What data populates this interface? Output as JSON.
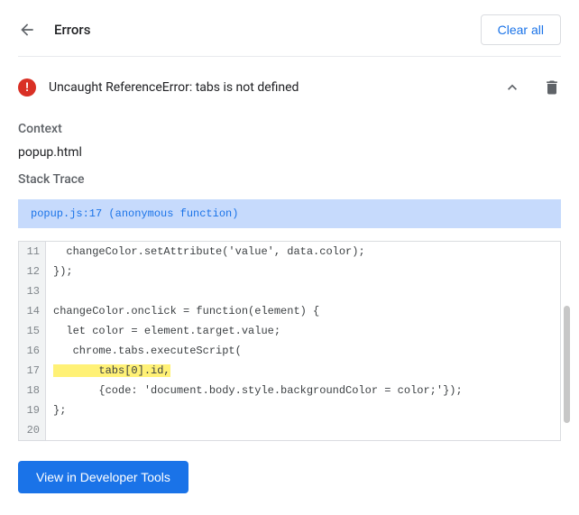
{
  "header": {
    "title": "Errors",
    "clear_all_label": "Clear all"
  },
  "error": {
    "message": "Uncaught ReferenceError: tabs is not defined"
  },
  "sections": {
    "context_label": "Context",
    "context_value": "popup.html",
    "stack_trace_label": "Stack Trace",
    "stack_frame": "popup.js:17 (anonymous function)"
  },
  "code": {
    "lines": [
      {
        "num": "11",
        "text": "  changeColor.setAttribute('value', data.color);",
        "highlight": false
      },
      {
        "num": "12",
        "text": "});",
        "highlight": false
      },
      {
        "num": "13",
        "text": "",
        "highlight": false
      },
      {
        "num": "14",
        "text": "changeColor.onclick = function(element) {",
        "highlight": false
      },
      {
        "num": "15",
        "text": "  let color = element.target.value;",
        "highlight": false
      },
      {
        "num": "16",
        "text": "   chrome.tabs.executeScript(",
        "highlight": false
      },
      {
        "num": "17",
        "text": "       tabs[0].id,",
        "highlight": true
      },
      {
        "num": "18",
        "text": "       {code: 'document.body.style.backgroundColor = color;'});",
        "highlight": false
      },
      {
        "num": "19",
        "text": "};",
        "highlight": false
      },
      {
        "num": "20",
        "text": "",
        "highlight": false
      }
    ]
  },
  "footer": {
    "dev_tools_label": "View in Developer Tools"
  }
}
